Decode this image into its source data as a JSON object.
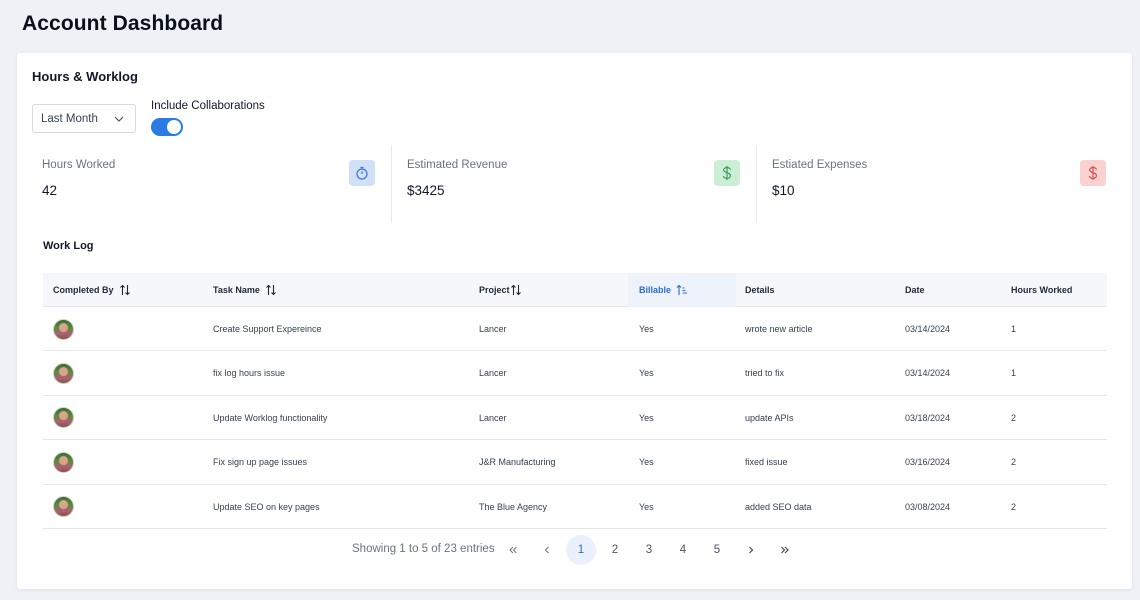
{
  "page": {
    "title": "Account Dashboard"
  },
  "card": {
    "title": "Hours & Worklog"
  },
  "filters": {
    "period_selected": "Last Month",
    "include_collab_label": "Include Collaborations",
    "include_collab_on": true
  },
  "stats": [
    {
      "label": "Hours Worked",
      "value": "42",
      "icon": "stopwatch-icon",
      "icon_bg": "#cfe0f7",
      "icon_color": "#3b76d6"
    },
    {
      "label": "Estimated Revenue",
      "value": "$3425",
      "icon": "dollar-icon",
      "icon_bg": "#cdeed6",
      "icon_color": "#2f9a52"
    },
    {
      "label": "Estiated Expenses",
      "value": "$10",
      "icon": "dollar-icon",
      "icon_bg": "#f9d2d0",
      "icon_color": "#d6453d"
    }
  ],
  "worklog": {
    "title": "Work Log",
    "columns": [
      "Completed By",
      "Task Name",
      "Project",
      "Billable",
      "Details",
      "Date",
      "Hours Worked"
    ],
    "rows": [
      {
        "task": "Create Support Expereince",
        "project": "Lancer",
        "billable": "Yes",
        "details": "wrote new article",
        "date": "03/14/2024",
        "hours": "1"
      },
      {
        "task": "fix log hours issue",
        "project": "Lancer",
        "billable": "Yes",
        "details": "tried to fix",
        "date": "03/14/2024",
        "hours": "1"
      },
      {
        "task": "Update Worklog functionality",
        "project": "Lancer",
        "billable": "Yes",
        "details": "update APIs",
        "date": "03/18/2024",
        "hours": "2"
      },
      {
        "task": "Fix sign up page issues",
        "project": "J&R Manufacturing",
        "billable": "Yes",
        "details": "fixed issue",
        "date": "03/16/2024",
        "hours": "2"
      },
      {
        "task": "Update SEO on key pages",
        "project": "The Blue Agency",
        "billable": "Yes",
        "details": "added SEO data",
        "date": "03/08/2024",
        "hours": "2"
      }
    ]
  },
  "pagination": {
    "info": "Showing 1 to 5 of 23 entries",
    "pages": [
      "1",
      "2",
      "3",
      "4",
      "5"
    ],
    "current": "1"
  },
  "colors": {
    "accent": "#2b7be4",
    "active_column": "#2b6cd1"
  }
}
